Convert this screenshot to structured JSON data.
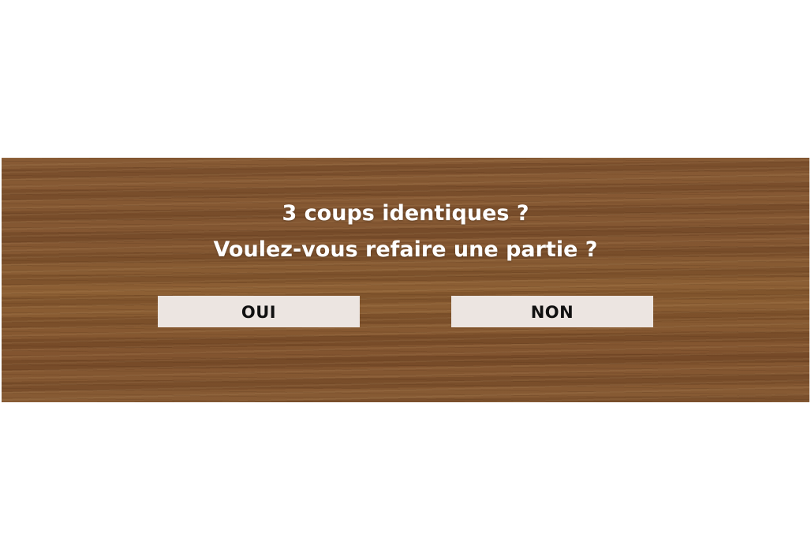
{
  "dialog": {
    "line1": "3 coups identiques ?",
    "line2": "Voulez-vous refaire une partie ?",
    "yes_label": "OUI",
    "no_label": "NON"
  },
  "colors": {
    "page_background": "#ffffff",
    "wood": "#7a4e2b",
    "button_background": "#ece5e1",
    "button_text": "#111111",
    "message_text": "#ffffff"
  }
}
